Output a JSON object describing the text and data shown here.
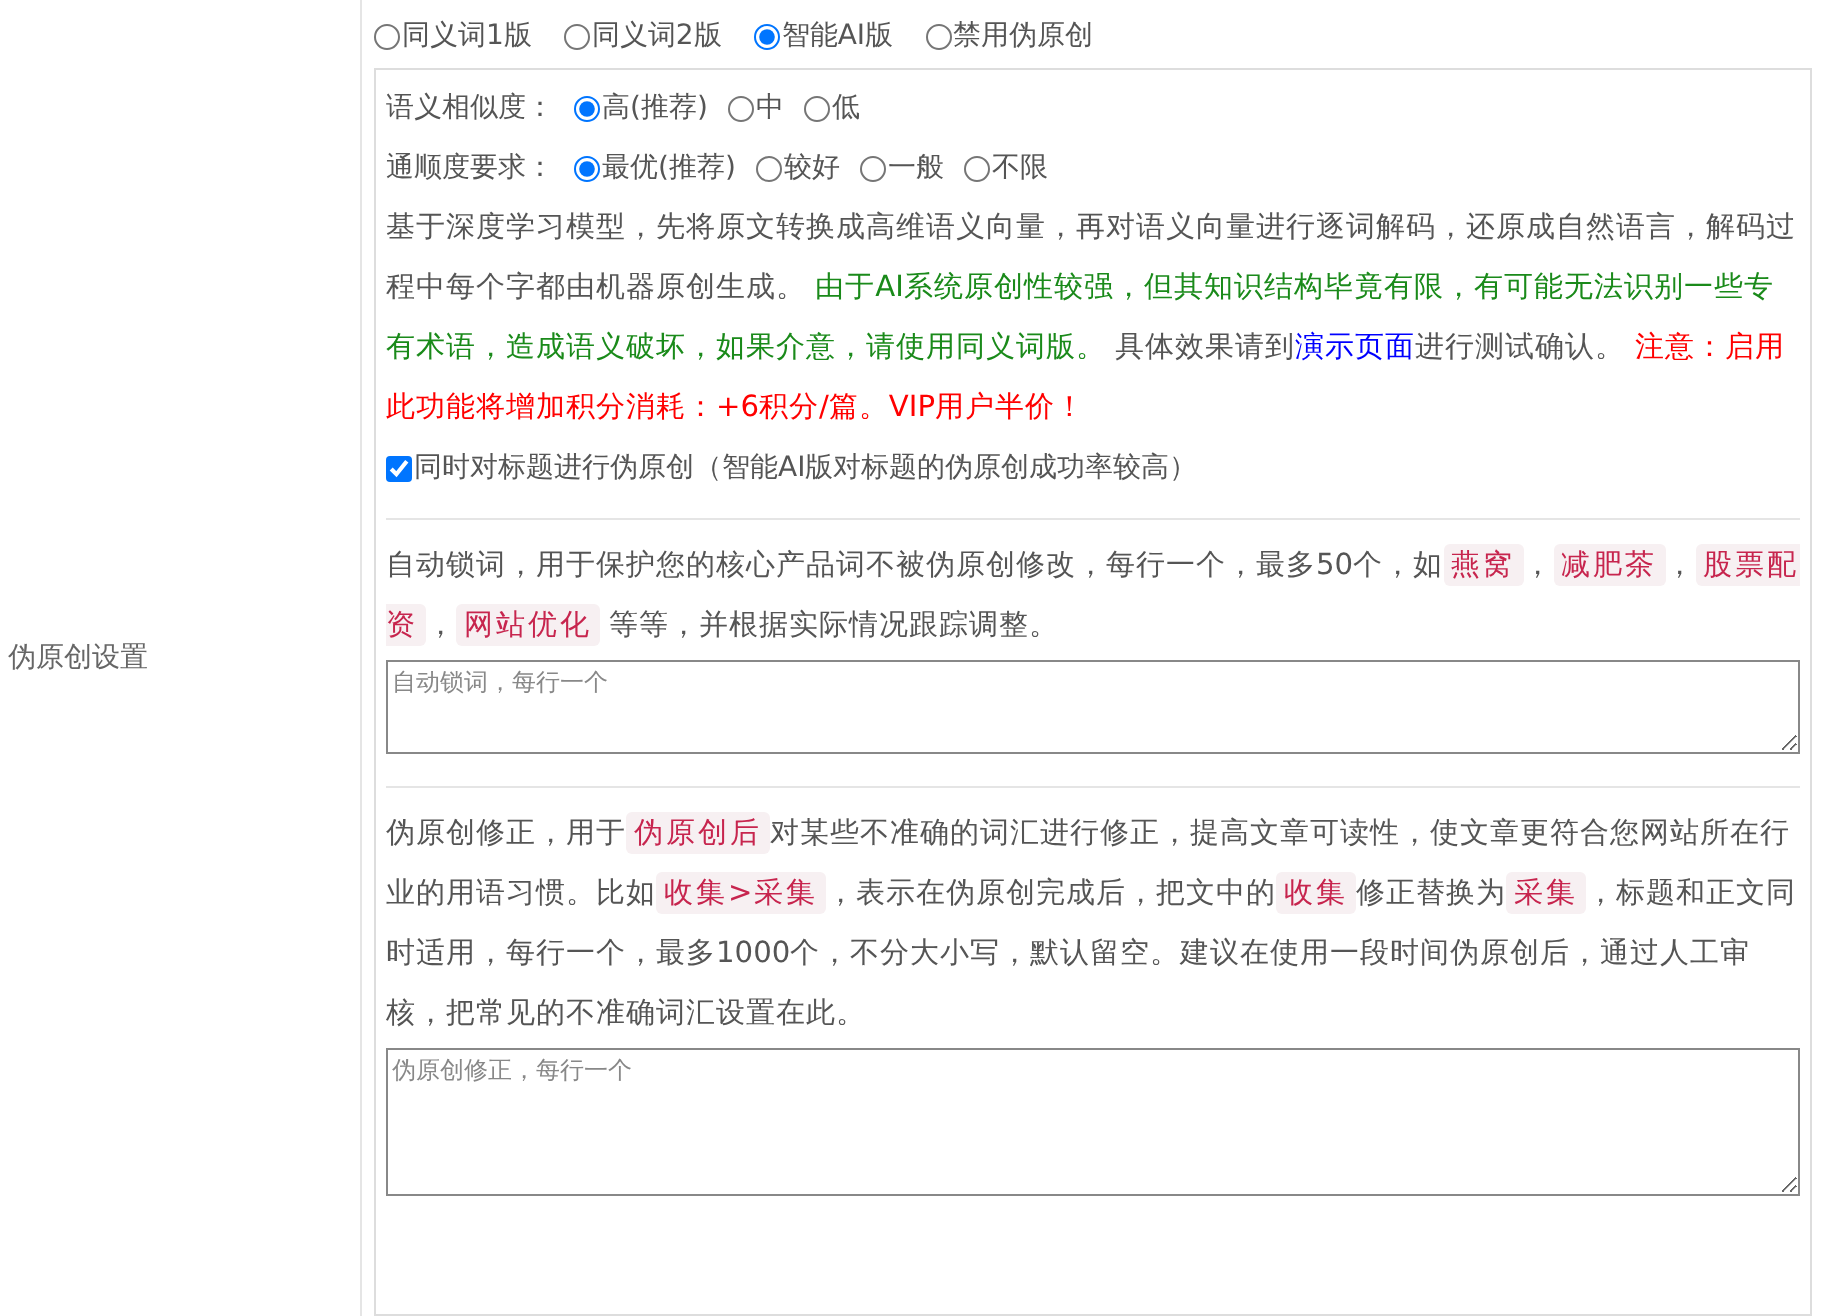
{
  "sidebar_label": "伪原创设置",
  "modes": [
    {
      "label": "同义词1版",
      "selected": false
    },
    {
      "label": "同义词2版",
      "selected": false
    },
    {
      "label": "智能AI版",
      "selected": true
    },
    {
      "label": "禁用伪原创",
      "selected": false
    }
  ],
  "similarity": {
    "label": "语义相似度：",
    "options": [
      {
        "label": "高(推荐)",
        "selected": true
      },
      {
        "label": "中",
        "selected": false
      },
      {
        "label": "低",
        "selected": false
      }
    ]
  },
  "fluency": {
    "label": "通顺度要求：",
    "options": [
      {
        "label": "最优(推荐)",
        "selected": true
      },
      {
        "label": "较好",
        "selected": false
      },
      {
        "label": "一般",
        "selected": false
      },
      {
        "label": "不限",
        "selected": false
      }
    ]
  },
  "ai_description": [
    {
      "kind": "plain",
      "text": "基于深度学习模型，先将原文转换成高维语义向量，再对语义向量进行逐词解码，还原成自然语言，解码过程中每个字都由机器原创生成。 "
    },
    {
      "kind": "notice",
      "text": "由于AI系统原创性较强，但其知识结构毕竟有限，有可能无法识别一些专有术语，造成语义破坏，如果介意，请使用同义词版。"
    },
    {
      "kind": "plain",
      "text": " 具体效果请到"
    },
    {
      "kind": "link",
      "text": "演示页面"
    },
    {
      "kind": "plain",
      "text": "进行测试确认。 "
    },
    {
      "kind": "warning",
      "text": "注意：启用此功能将增加积分消耗：+6积分/篇。VIP用户半价！"
    }
  ],
  "title_option": {
    "label": "同时对标题进行伪原创（智能AI版对标题的伪原创成功率较高）",
    "checked": true
  },
  "lock_words": {
    "description": [
      {
        "kind": "plain",
        "text": "自动锁词，用于保护您的核心产品词不被伪原创修改，每行一个，最多50个，如"
      },
      {
        "kind": "tag",
        "text": "燕窝"
      },
      {
        "kind": "plain",
        "text": "，"
      },
      {
        "kind": "tag",
        "text": "减肥茶"
      },
      {
        "kind": "plain",
        "text": "，"
      },
      {
        "kind": "tag",
        "text": "股票配资"
      },
      {
        "kind": "plain",
        "text": "，"
      },
      {
        "kind": "tag",
        "text": "网站优化"
      },
      {
        "kind": "plain",
        "text": " 等等，并根据实际情况跟踪调整。"
      }
    ],
    "placeholder": "自动锁词，每行一个"
  },
  "correction": {
    "description": [
      {
        "kind": "plain",
        "text": "伪原创修正，用于"
      },
      {
        "kind": "tag",
        "text": "伪原创后"
      },
      {
        "kind": "plain",
        "text": "对某些不准确的词汇进行修正，提高文章可读性，使文章更符合您网站所在行业的用语习惯。比如"
      },
      {
        "kind": "tag",
        "text": "收集>采集"
      },
      {
        "kind": "plain",
        "text": "，表示在伪原创完成后，把文中的"
      },
      {
        "kind": "tag",
        "text": "收集"
      },
      {
        "kind": "plain",
        "text": "修正替换为"
      },
      {
        "kind": "tag",
        "text": "采集"
      },
      {
        "kind": "plain",
        "text": "，标题和正文同时适用，每行一个，最多1000个，不分大小写，默认留空。建议在使用一段时间伪原创后，通过人工审核，把常见的不准确词汇设置在此。"
      }
    ],
    "placeholder": "伪原创修正，每行一个"
  }
}
